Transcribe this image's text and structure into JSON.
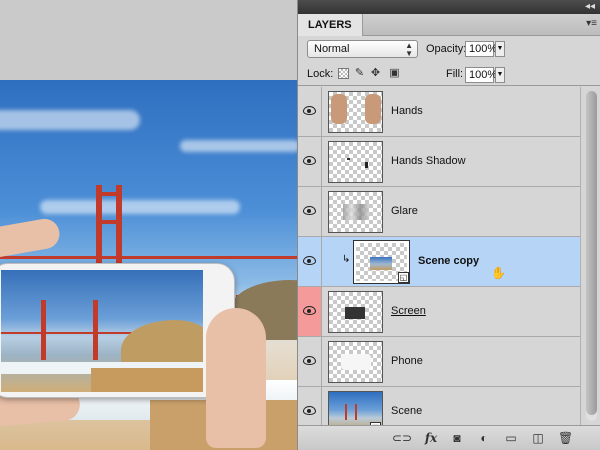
{
  "panel": {
    "tab_label": "LAYERS",
    "collapse_glyph": "◂◂",
    "menu_glyph": "▾≡",
    "blend_mode": "Normal",
    "opacity_label": "Opacity:",
    "opacity_value": "100%",
    "lock_label": "Lock:",
    "fill_label": "Fill:",
    "fill_value": "100%",
    "lock_icons": [
      "lock-transparent-icon",
      "lock-image-icon",
      "lock-position-icon",
      "lock-all-icon"
    ]
  },
  "layers": [
    {
      "name": "Hands",
      "visible": true,
      "selected": false
    },
    {
      "name": "Hands Shadow",
      "visible": true,
      "selected": false
    },
    {
      "name": "Glare",
      "visible": true,
      "selected": false
    },
    {
      "name": "Scene copy",
      "visible": true,
      "selected": true,
      "clipped": true,
      "smart_object": true
    },
    {
      "name": "Screen",
      "visible": true,
      "selected": false,
      "color_label": "red"
    },
    {
      "name": "Phone",
      "visible": true,
      "selected": false
    },
    {
      "name": "Scene",
      "visible": true,
      "selected": false,
      "smart_object": true
    }
  ],
  "bottom_icons": [
    "link-layers-icon",
    "fx-icon",
    "layer-mask-icon",
    "adjustment-layer-icon",
    "new-group-icon",
    "new-layer-icon",
    "delete-layer-icon"
  ],
  "bottom_labels": {
    "fx": "fx"
  },
  "colors": {
    "selection": "#b6d4f6",
    "red_label": "#f59a9a"
  }
}
